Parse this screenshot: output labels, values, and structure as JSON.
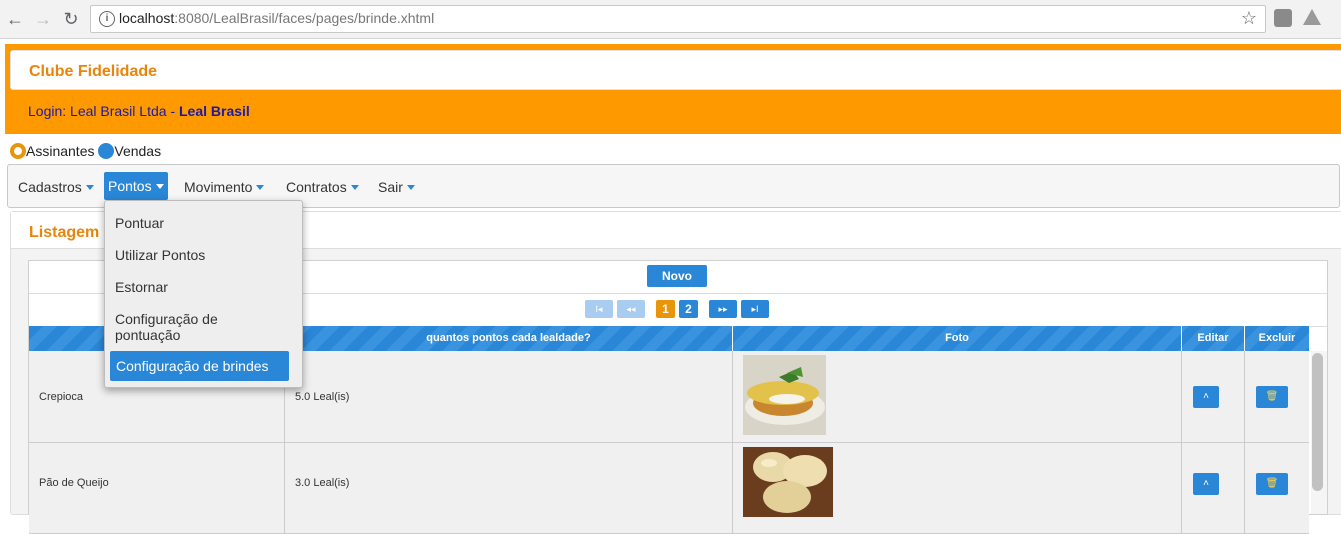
{
  "browser": {
    "url_host": "localhost",
    "url_path": ":8080/LealBrasil/faces/pages/brinde.xhtml"
  },
  "header": {
    "site_title": "Clube Fidelidade",
    "login_label": "Login: Leal Brasil Ltda",
    "separator": "-",
    "login_user": "Leal Brasil"
  },
  "radio_options": [
    {
      "label": "Assinantes",
      "selected": true
    },
    {
      "label": "Vendas",
      "selected": false
    }
  ],
  "menu": {
    "items": [
      {
        "label": "Cadastros"
      },
      {
        "label": "Pontos",
        "active": true
      },
      {
        "label": "Movimento"
      },
      {
        "label": "Contratos"
      },
      {
        "label": "Sair"
      }
    ],
    "dropdown": [
      {
        "label": "Pontuar"
      },
      {
        "label": "Utilizar Pontos"
      },
      {
        "label": "Estornar"
      },
      {
        "label": "Configuração de pontuação"
      },
      {
        "label": "Configuração de brindes",
        "selected": true
      }
    ]
  },
  "panel": {
    "title": "Listagem"
  },
  "grid": {
    "new_button": "Novo",
    "pager": {
      "first": "I◂",
      "prev": "◂◂",
      "pages": [
        "1",
        "2"
      ],
      "current_page": "1",
      "next": "▸▸",
      "last": "▸I"
    },
    "columns": [
      "",
      "quantos pontos cada lealdade?",
      "Foto",
      "Editar",
      "Excluir"
    ],
    "rows": [
      {
        "name": "Crepioca",
        "points": "5.0 Leal(is)"
      },
      {
        "name": "Pão de Queijo",
        "points": "3.0 Leal(is)"
      }
    ]
  },
  "colors": {
    "accent_orange": "#ff9900",
    "title_orange": "#e8850b",
    "primary_blue": "#2a86d6",
    "login_blue": "#1a1aa6"
  },
  "icons": [
    "back-arrow-icon",
    "forward-arrow-icon",
    "reload-icon",
    "info-icon",
    "star-icon",
    "extension-icon",
    "drive-icon",
    "chevron-up-icon",
    "trash-icon",
    "caret-down-icon"
  ]
}
